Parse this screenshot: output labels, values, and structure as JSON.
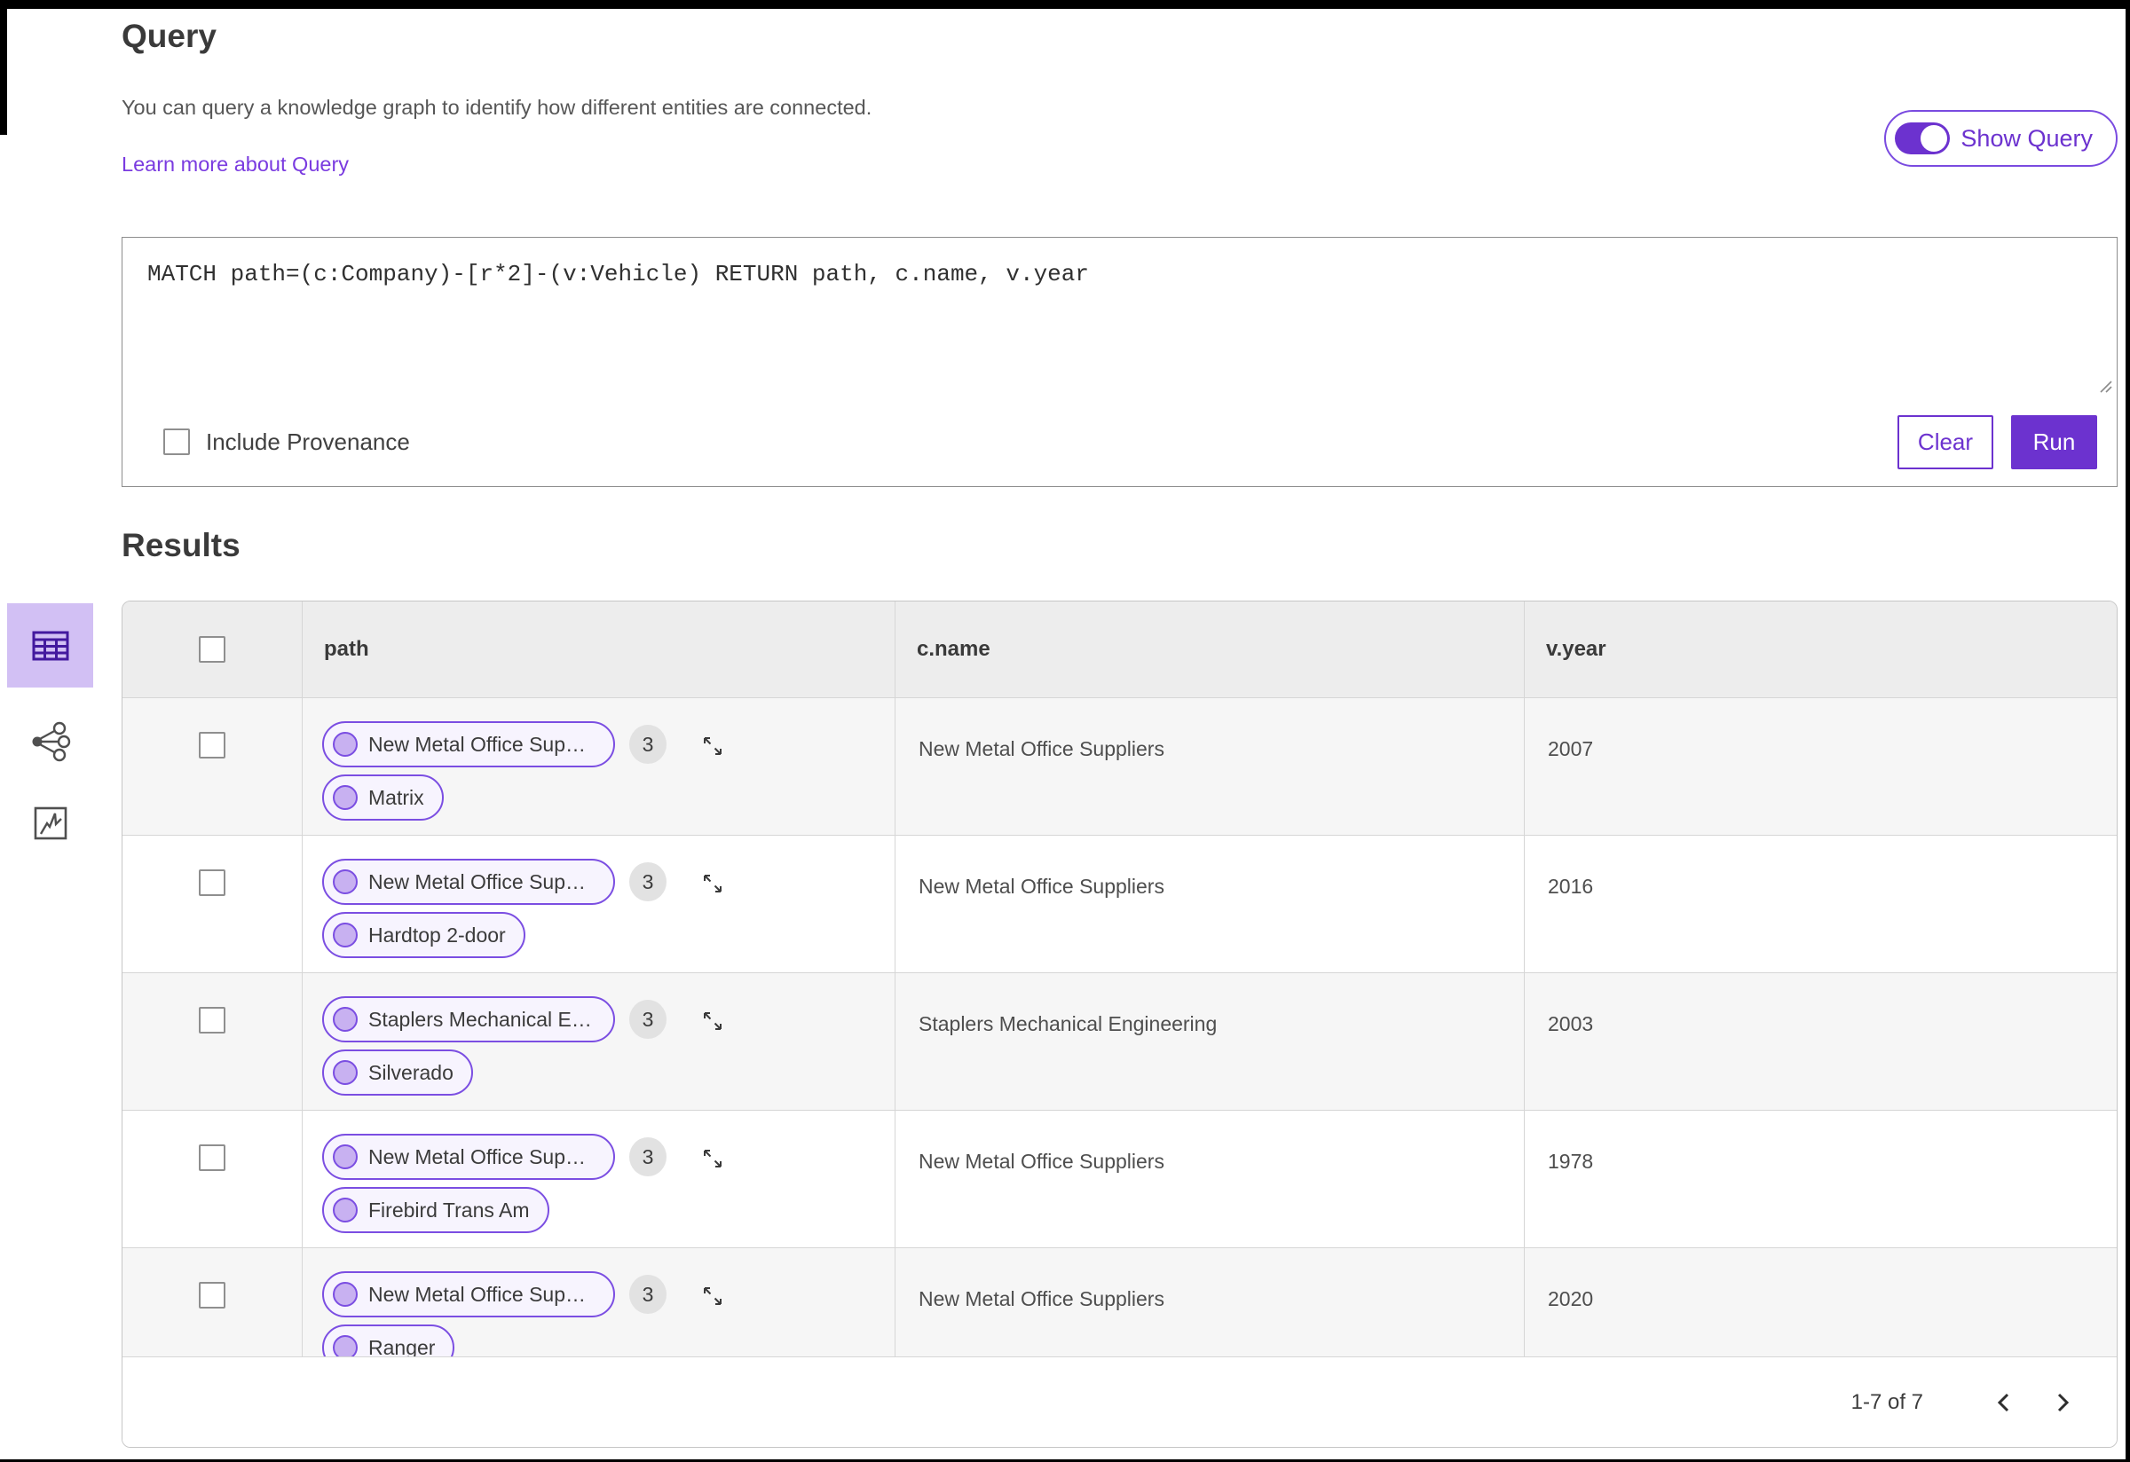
{
  "header": {
    "title": "Query",
    "description": "You can query a knowledge graph to identify how different entities are connected.",
    "learn_more": "Learn more about Query",
    "show_query_label": "Show Query",
    "show_query_on": true
  },
  "query_editor": {
    "query_text": "MATCH path=(c:Company)-[r*2]-(v:Vehicle) RETURN path, c.name, v.year",
    "include_provenance_label": "Include Provenance",
    "include_provenance_checked": false,
    "clear_label": "Clear",
    "run_label": "Run"
  },
  "results": {
    "title": "Results",
    "views": [
      "table-view",
      "graph-view",
      "chart-view"
    ],
    "selected_view": "table-view",
    "columns": [
      "path",
      "c.name",
      "v.year"
    ],
    "rows": [
      {
        "path_pills": [
          "New Metal Office Suppliers",
          "Matrix"
        ],
        "badge": "3",
        "c_name": "New Metal Office Suppliers",
        "v_year": "2007"
      },
      {
        "path_pills": [
          "New Metal Office Suppliers",
          "Hardtop 2-door"
        ],
        "badge": "3",
        "c_name": "New Metal Office Suppliers",
        "v_year": "2016"
      },
      {
        "path_pills": [
          "Staplers Mechanical Engi...",
          "Silverado"
        ],
        "badge": "3",
        "c_name": "Staplers Mechanical Engineering",
        "v_year": "2003"
      },
      {
        "path_pills": [
          "New Metal Office Suppliers",
          "Firebird Trans Am"
        ],
        "badge": "3",
        "c_name": "New Metal Office Suppliers",
        "v_year": "1978"
      },
      {
        "path_pills": [
          "New Metal Office Suppliers",
          "Ranger"
        ],
        "badge": "3",
        "c_name": "New Metal Office Suppliers",
        "v_year": "2020"
      }
    ],
    "pagination": {
      "range_label": "1-7 of 7"
    }
  },
  "colors": {
    "accent": "#6c32cf",
    "pill_border": "#7b4ee2",
    "pill_bg": "#f7f4fe",
    "node_fill": "#c8b1f1",
    "selected_view_bg": "#d2c0f4",
    "table_header_bg": "#ededed",
    "row_alt_bg": "#f6f6f6",
    "link": "#7a3be0"
  }
}
